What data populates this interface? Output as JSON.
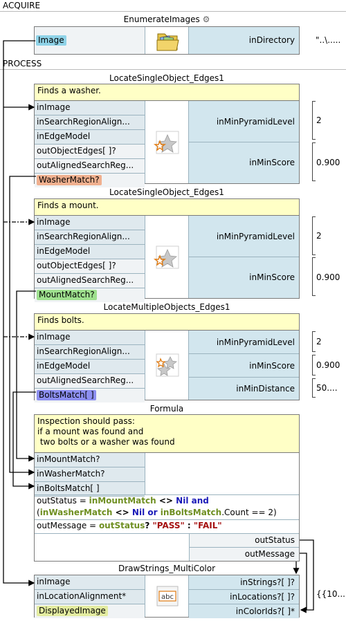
{
  "sections": {
    "acquire": "ACQUIRE",
    "process": "PROCESS"
  },
  "enumerate": {
    "title": "EnumerateImages",
    "output": "Image",
    "input_label": "inDirectory",
    "input_value": "\"..\\.....",
    "output_color": "#8fd3e8",
    "icon": "folder-images-icon"
  },
  "locate1": {
    "title": "LocateSingleObject_Edges1",
    "comment": "Finds a washer.",
    "ports": [
      "inImage",
      "inSearchRegionAlign...",
      "inEdgeModel",
      "outObjectEdges[ ]?",
      "outAlignedSearchReg..."
    ],
    "output": "WasherMatch?",
    "output_color": "#f0b08f",
    "params": [
      {
        "label": "inMinPyramidLevel",
        "value": "2"
      },
      {
        "label": "inMinScore",
        "value": "0.900"
      }
    ]
  },
  "locate2": {
    "title": "LocateSingleObject_Edges1",
    "comment": "Finds a mount.",
    "ports": [
      "inImage",
      "inSearchRegionAlign...",
      "inEdgeModel",
      "outObjectEdges[ ]?",
      "outAlignedSearchReg..."
    ],
    "output": "MountMatch?",
    "output_color": "#9ee08e",
    "params": [
      {
        "label": "inMinPyramidLevel",
        "value": "2"
      },
      {
        "label": "inMinScore",
        "value": "0.900"
      }
    ]
  },
  "locate3": {
    "title": "LocateMultipleObjects_Edges1",
    "comment": "Finds bolts.",
    "ports": [
      "inImage",
      "inSearchRegionAlign...",
      "inEdgeModel",
      "outAlignedSearchReg..."
    ],
    "output": "BoltsMatch[ ]",
    "output_color": "#8c8ef0",
    "params": [
      {
        "label": "inMinPyramidLevel",
        "value": "2"
      },
      {
        "label": "inMinScore",
        "value": "0.900"
      },
      {
        "label": "inMinDistance",
        "value": "50...."
      }
    ]
  },
  "formula": {
    "title": "Formula",
    "comment_lines": [
      "Inspection should pass:",
      "if a mount was found and",
      " two bolts or a washer was found"
    ],
    "inputs": [
      "inMountMatch?",
      "inWasherMatch?",
      "inBoltsMatch[ ]"
    ],
    "code1": {
      "a": "outStatus = ",
      "b": "inMountMatch",
      "c": " <> ",
      "d": "Nil",
      "e": " and"
    },
    "code2": {
      "a": "(",
      "b": "inWasherMatch",
      "c": " <> ",
      "d": "Nil",
      "e": " or ",
      "f": "inBoltsMatch",
      "g": ".Count == 2)"
    },
    "code3": {
      "a": "outMessage = ",
      "b": "outStatus",
      "c": "? ",
      "d": "\"PASS\"",
      "e": " : ",
      "f": "\"FAIL\""
    },
    "outputs": [
      "outStatus",
      "outMessage"
    ]
  },
  "draw": {
    "title": "DrawStrings_MultiColor",
    "left_ports": [
      "inImage",
      "inLocationAlignment*"
    ],
    "output": "DisplayedImage",
    "output_color": "#e3eca0",
    "right_ports": [
      "inStrings?[ ]?",
      "inLocations?[ ]?",
      "inColorIds?[ ]*"
    ],
    "locations_value": "{{10...",
    "icon": "abc-text-icon"
  }
}
